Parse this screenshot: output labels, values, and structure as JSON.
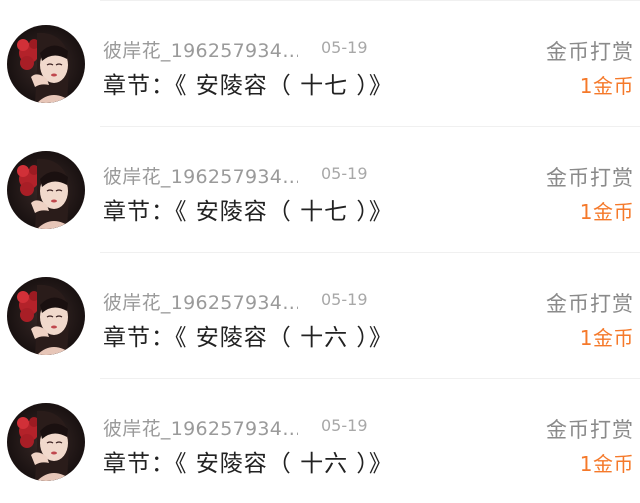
{
  "theme": {
    "accent": "#f5792a",
    "muted_text": "#9a9a9a",
    "primary_text": "#222222"
  },
  "records": [
    {
      "username": "彼岸花_196257934…",
      "date": "05-19",
      "chapter": "章节：《 安陵容（ 十七 ）》",
      "reward_type": "金币打赏",
      "amount": "1金币",
      "avatar_icon": "user-avatar"
    },
    {
      "username": "彼岸花_196257934…",
      "date": "05-19",
      "chapter": "章节：《 安陵容（ 十七 ）》",
      "reward_type": "金币打赏",
      "amount": "1金币",
      "avatar_icon": "user-avatar"
    },
    {
      "username": "彼岸花_196257934…",
      "date": "05-19",
      "chapter": "章节：《 安陵容（ 十六 ）》",
      "reward_type": "金币打赏",
      "amount": "1金币",
      "avatar_icon": "user-avatar"
    },
    {
      "username": "彼岸花_196257934…",
      "date": "05-19",
      "chapter": "章节：《 安陵容（ 十六 ）》",
      "reward_type": "金币打赏",
      "amount": "1金币",
      "avatar_icon": "user-avatar"
    }
  ]
}
